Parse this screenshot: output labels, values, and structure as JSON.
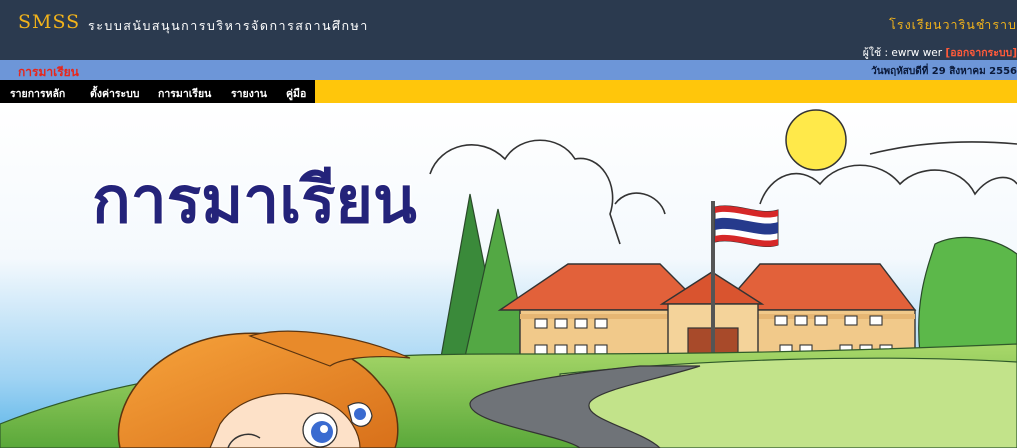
{
  "header": {
    "logo": "SMSS",
    "title": "ระบบสนับสนุนการบริหารจัดการสถานศึกษา",
    "school_name": "โรงเรียนวารินชำราบ",
    "user_prefix": "ผู้ใช้ : ",
    "user_name": "ewrw wer",
    "logout": "[ออกจากระบบ]"
  },
  "subbar": {
    "page_name": "การมาเรียน",
    "date": "วันพฤหัสบดีที่ 29 สิงหาคม 2556"
  },
  "menu": {
    "items": [
      {
        "label": "รายการหลัก"
      },
      {
        "label": "ตั้งค่าระบบ"
      },
      {
        "label": "การมาเรียน"
      },
      {
        "label": "รายงาน"
      },
      {
        "label": "คู่มือ"
      }
    ]
  },
  "banner": {
    "title": "การมาเรียน"
  },
  "colors": {
    "header_bg": "#2b3a4f",
    "accent_gold": "#f2b31b",
    "subbar_bg": "#6d96d8",
    "page_name": "#e8261a",
    "menu_bg": "#000000",
    "menu_fill": "#ffc60b",
    "banner_title": "#24237a"
  }
}
